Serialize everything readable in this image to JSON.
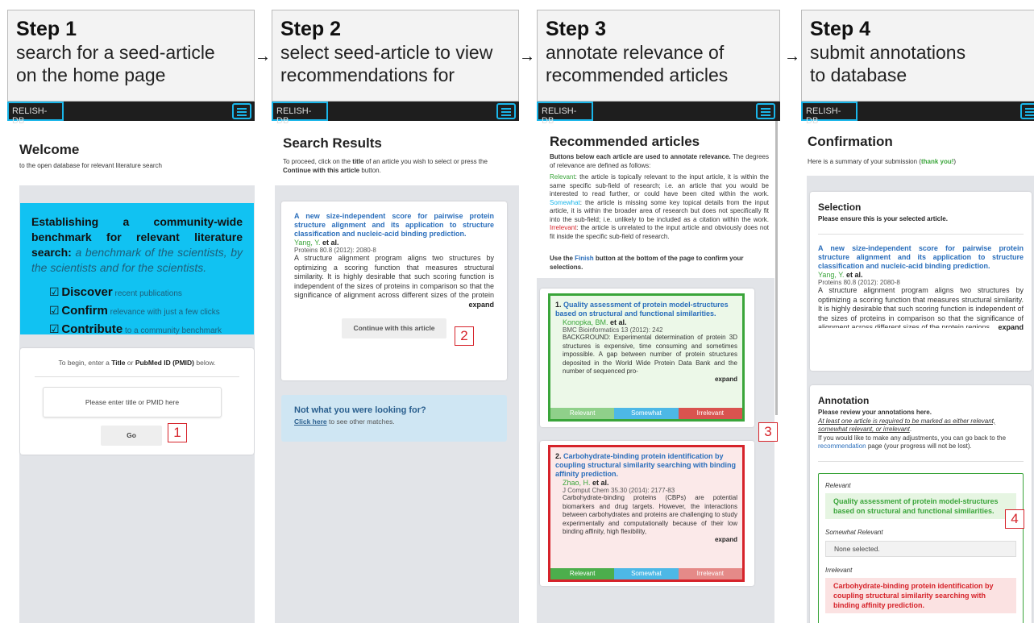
{
  "app": {
    "brand": "RELISH-DB"
  },
  "steps": [
    {
      "title": "Step 1",
      "desc_lines": [
        "search for a seed-article",
        "on the home page"
      ]
    },
    {
      "title": "Step 2",
      "desc_lines": [
        "select seed-article to view",
        "recommendations for"
      ]
    },
    {
      "title": "Step 3",
      "desc_lines": [
        "annotate relevance of",
        "recommended articles"
      ]
    },
    {
      "title": "Step 4",
      "desc_lines": [
        "submit annotations",
        "to database"
      ]
    }
  ],
  "arrow": "→",
  "markers": [
    "1",
    "2",
    "3",
    "4"
  ],
  "welcome": {
    "title": "Welcome",
    "subtitle": "to the open database for relevant literature search",
    "hero_lead": "Establishing a community-wide benchmark for relevant literature search:",
    "hero_rest": " a benchmark of the scientists, by the scientists and for the scientists.",
    "features": [
      {
        "icon": "check-square-icon",
        "bold": "Discover",
        "rest": " recent publications"
      },
      {
        "icon": "check-square-icon",
        "bold": "Confirm",
        "rest": " relevance with just a few clicks"
      },
      {
        "icon": "check-square-icon",
        "bold": "Contribute",
        "rest": " to a community benchmark"
      }
    ],
    "begin_a": "To begin, enter a ",
    "begin_b": "Title",
    "begin_c": " or ",
    "begin_d": "PubMed ID (PMID)",
    "begin_e": " below.",
    "search_placeholder": "Please enter title or PMID here",
    "go_label": "Go"
  },
  "search": {
    "title": "Search Results",
    "instr_a": "To proceed, click on the ",
    "instr_b": "title",
    "instr_c": " of an article you wish to select or press the ",
    "instr_d": "Continue with this article",
    "instr_e": " button.",
    "article_title": "A new size-independent score for pairwise protein structure alignment and its application to structure classification and nucleic-acid binding prediction.",
    "authors": "Yang, Y.",
    "etal": " et al.",
    "journal": "Proteins 80.8 (2012): 2080-8",
    "abstract": "A structure alignment program aligns two structures by optimizing a scoring function that measures structural similarity. It is highly desirable that such scoring function is independent of the sizes of proteins in comparison so that the significance of alignment across different sizes of the protein regions",
    "expand": "expand",
    "continue_label": "Continue with this article",
    "notfound_title": "Not what you were looking for?",
    "click_here": "Click here",
    "notfound_rest": " to see other matches."
  },
  "recommended": {
    "title": "Recommended articles",
    "intro_a": "Buttons below each article are used to annotate relevance.",
    "intro_b": " The degrees of relevance are defined as follows:",
    "relevant_term": "Relevant",
    "relevant_def": ": the article is topically relevant to the input article, it is within the same specific sub-field of research; i.e. an article that you would be interested to read further, or could have been cited within the work.",
    "somewhat_term": "Somewhat",
    "somewhat_def": ": the article is missing some key topical details from the input article, it is within the broader area of research but does not specifically fit into the sub-field; i.e. unlikely to be included as a citation within the work.",
    "irrelevant_term": "Irrelevant",
    "irrelevant_def": ": the article is unrelated to the input article and obviously does not fit inside the specific sub-field of research.",
    "finish_a": "Use the ",
    "finish_b": "Finish",
    "finish_c": " button at the bottom of the page to confirm your selections.",
    "articles": [
      {
        "num": "1.",
        "title": "Quality assessment of protein model-structures based on structural and functional similarities.",
        "authors": "Konopka, BM.",
        "etal": " et al.",
        "journal": "BMC Bioinformatics 13 (2012): 242",
        "abstract": "BACKGROUND: Experimental determination of protein 3D structures is expensive, time consuming and sometimes impossible. A gap between number of protein structures deposited in the World Wide Protein Data Bank and the number of sequenced pro-",
        "expand": "expand"
      },
      {
        "num": "2.",
        "title": "Carbohydrate-binding protein identification by coupling structural similarity searching with binding affinity prediction.",
        "authors": "Zhao, H.",
        "etal": " et al.",
        "journal": "J Comput Chem 35.30 (2014): 2177-83",
        "abstract": "Carbohydrate-binding proteins (CBPs) are potential biomarkers and drug targets. However, the interactions between carbohydrates and proteins are challenging to study experimentally and computationally because of their low binding affinity, high flexibility,",
        "expand": "expand"
      }
    ],
    "btn_relevant": "Relevant",
    "btn_somewhat": "Somewhat",
    "btn_irrelevant": "Irrelevant"
  },
  "confirmation": {
    "title": "Confirmation",
    "subtitle_a": "Here is a summary of your submission (",
    "thank": "thank you!",
    "subtitle_b": ")",
    "selection_title": "Selection",
    "selection_note": "Please ensure this is your selected article.",
    "article_title": "A new size-independent score for pairwise protein structure alignment and its application to structure classification and nucleic-acid binding prediction.",
    "authors": "Yang, Y.",
    "etal": " et al.",
    "journal": "Proteins 80.8 (2012): 2080-8",
    "abstract": "A structure alignment program aligns two structures by optimizing a scoring function that measures structural similarity. It is highly desirable that such scoring function is independent of the sizes of proteins in comparison so that the significance of alignment across different sizes of the protein regions",
    "expand": "expand",
    "annotation_title": "Annotation",
    "review_bold": "Please review your annotations here.",
    "review_italic": "At least one article is required to be marked as either relevant, somewhat relevant, or irrelevant",
    "review_dot": ".",
    "adjust_a": "If you would like to make any adjustments, you can go back to the ",
    "adjust_link": "recommendation",
    "adjust_b": " page (your progress will not be lost).",
    "relevant_label": "Relevant",
    "relevant_item": "Quality assessment of protein model-structures based on structural and functional similarities.",
    "somewhat_label": "Somewhat Relevant",
    "somewhat_item": "None selected.",
    "irrelevant_label": "Irrelevant",
    "irrelevant_item": "Carbohydrate-binding protein identification by coupling structural similarity searching with binding affinity prediction."
  },
  "colors": {
    "accent": "#1ab6ea",
    "link": "#2a6ebb",
    "green": "#3aa53a",
    "red": "#d6232a",
    "hero": "#11c2f2"
  }
}
